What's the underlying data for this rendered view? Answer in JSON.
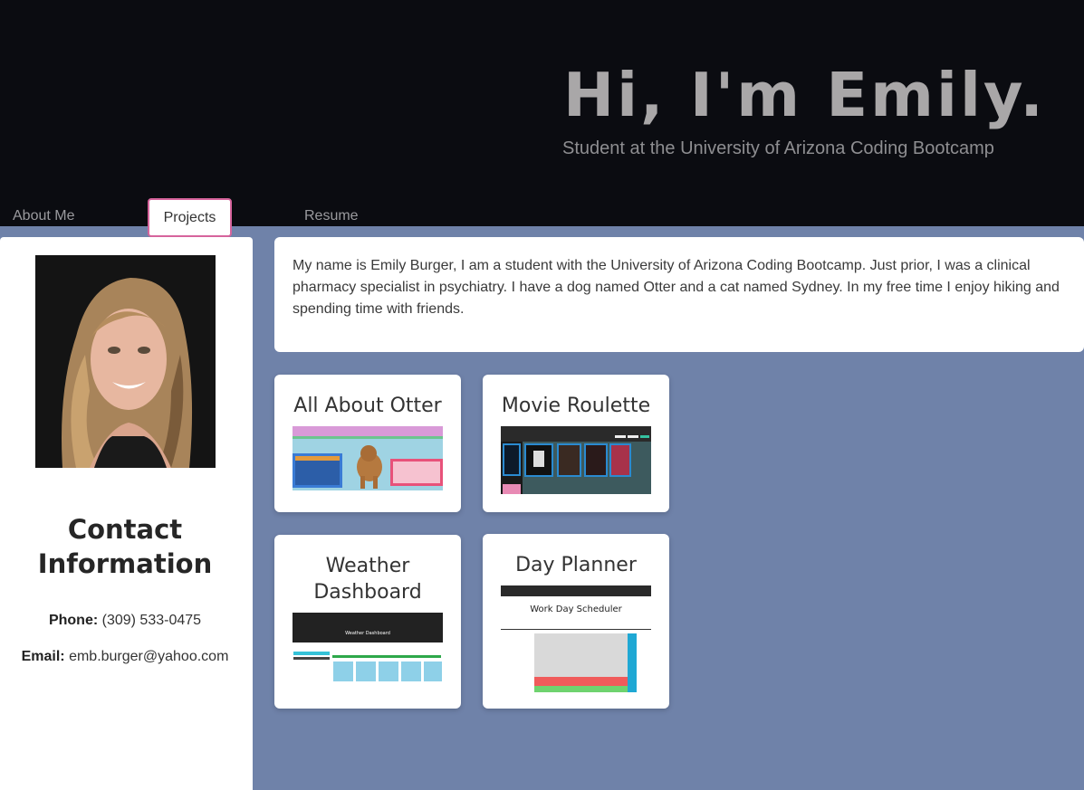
{
  "header": {
    "title": "Hi, I'm Emily.",
    "subtitle": "Student at the University of Arizona Coding Bootcamp"
  },
  "nav": {
    "items": [
      {
        "label": "About Me"
      },
      {
        "label": "Projects",
        "active": true
      },
      {
        "label": "Resume"
      }
    ]
  },
  "sidebar": {
    "contact_title": "Contact Information",
    "phone_label": "Phone:",
    "phone_value": "(309) 533-0475",
    "email_label": "Email:",
    "email_value": "emb.burger@yahoo.com"
  },
  "about": {
    "text": "My name is Emily Burger, I am a student with the University of Arizona Coding Bootcamp. Just prior, I was a clinical pharmacy specialist in psychiatry. I have a dog named Otter and a cat named Sydney. In my free time I enjoy hiking and spending time with friends."
  },
  "projects": [
    {
      "title": "All About Otter"
    },
    {
      "title": "Movie Roulette"
    },
    {
      "title": "Weather Dashboard"
    },
    {
      "title": "Day Planner"
    }
  ],
  "thumbnails": {
    "weather_heading": "Weather Dashboard",
    "planner_heading": "Work Day Scheduler"
  },
  "colors": {
    "header_bg": "#0b0c11",
    "page_bg": "#6f82a9",
    "active_tab_border": "#d6649c"
  }
}
